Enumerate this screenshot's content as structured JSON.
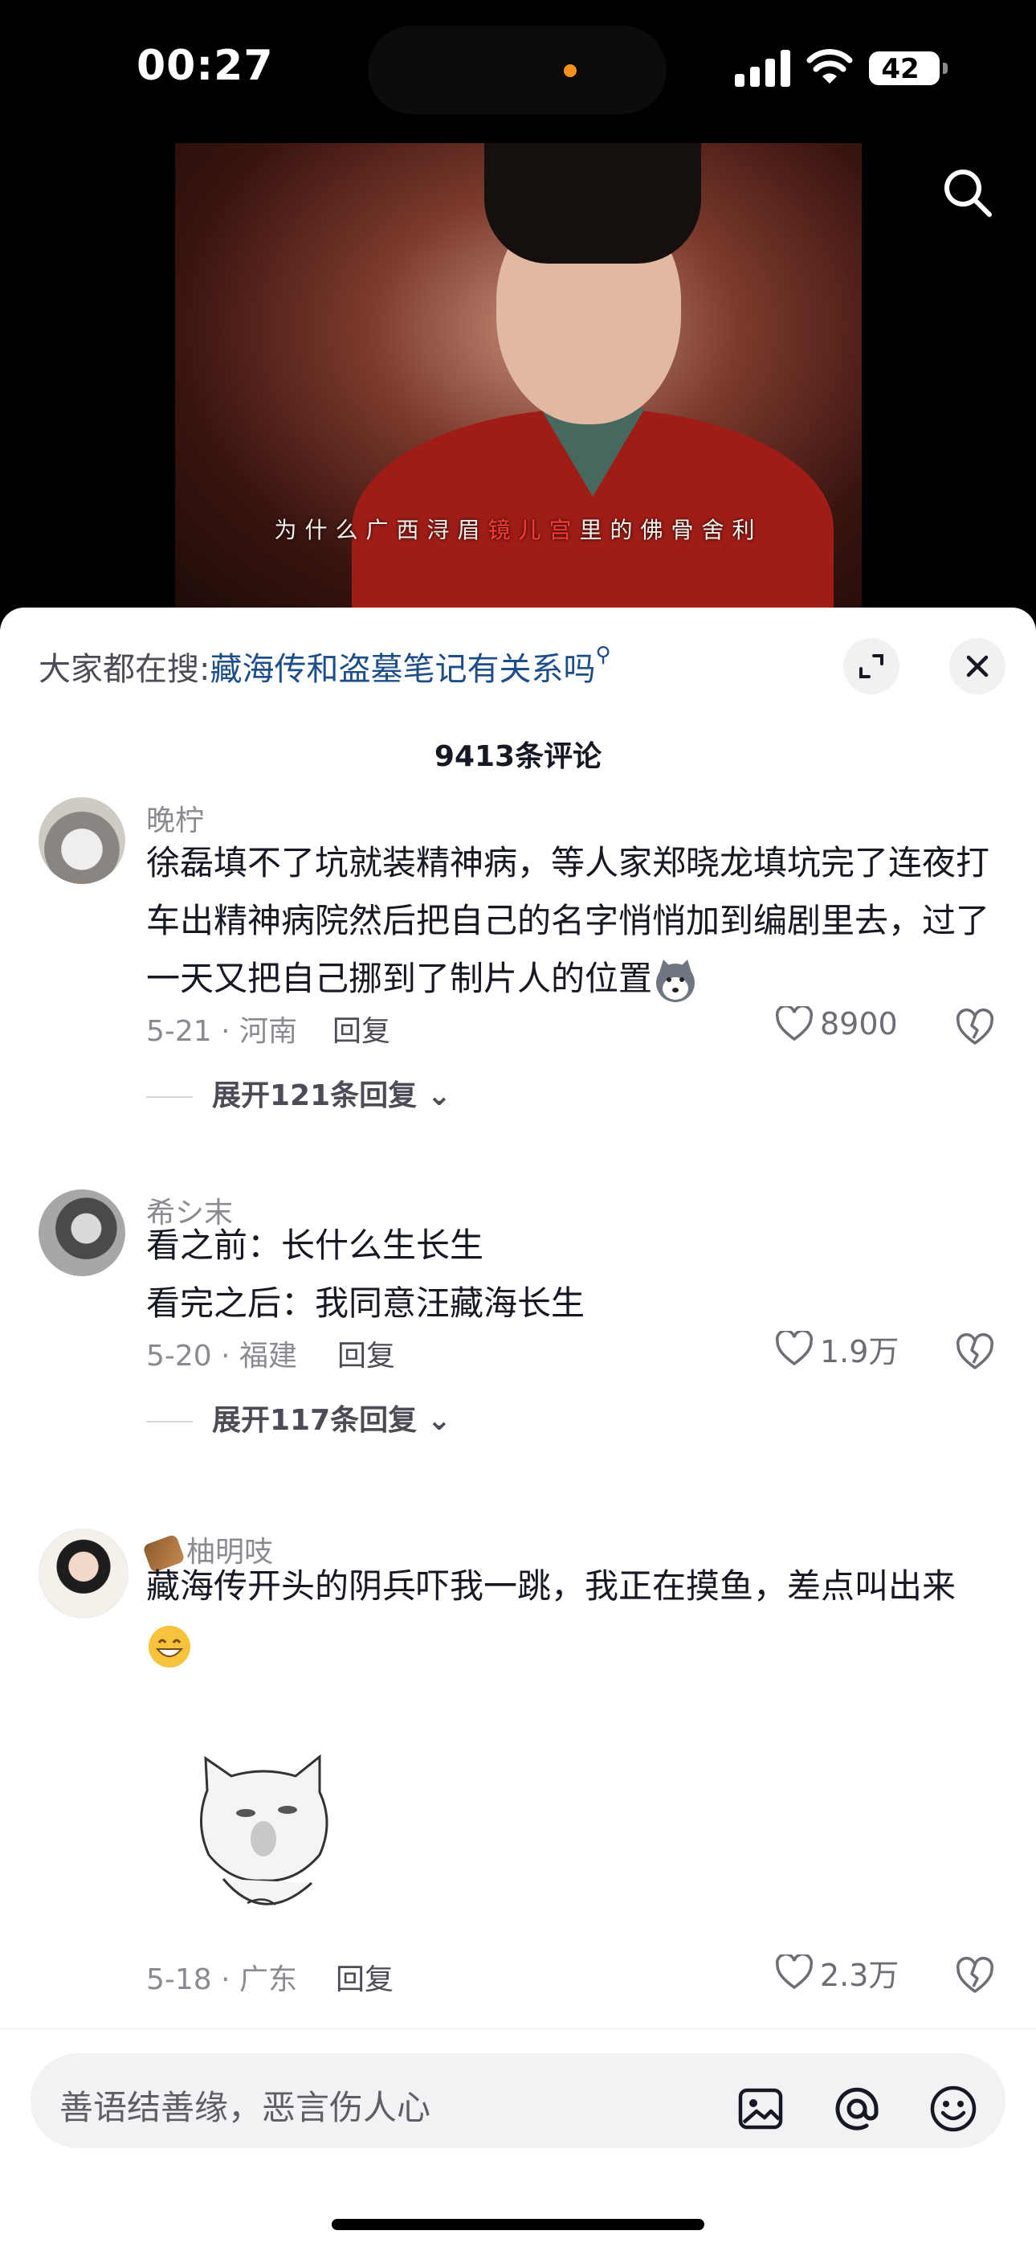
{
  "status_bar": {
    "time": "00:27",
    "battery": "42"
  },
  "video": {
    "subtitle_parts": [
      "为什么广西浔眉",
      "镜儿宫",
      "里的佛骨舍利"
    ]
  },
  "sheet": {
    "hot_search_prefix": "大家都在搜:",
    "hot_search_query": "藏海传和盗墓笔记有关系吗",
    "comment_count": "9413条评论"
  },
  "comments": [
    {
      "name": "晚柠",
      "text": "徐磊填不了坑就装精神病，等人家郑晓龙填坑完了连夜打车出精神病院然后把自己的名字悄悄加到编剧里去，过了一天又把自己挪到了制片人的位置",
      "date_loc": "5-21 · 河南",
      "reply": "回复",
      "likes": "8900",
      "expand": "展开121条回复"
    },
    {
      "name": "希シ末",
      "text_line1": "看之前：长什么生长生",
      "text_line2": "看完之后：我同意汪藏海长生",
      "date_loc": "5-20 · 福建",
      "reply": "回复",
      "likes": "1.9万",
      "expand": "展开117条回复"
    },
    {
      "name": "柚明吱",
      "text": "藏海传开头的阴兵吓我一跳，我正在摸鱼，差点叫出来",
      "date_loc": "5-18 · 广东",
      "reply": "回复",
      "likes": "2.3万"
    }
  ],
  "input_bar": {
    "placeholder": "善语结善缘，恶言伤人心"
  },
  "icons": {
    "search": "search-icon",
    "expand": "expand-icon",
    "close": "close-icon",
    "heart": "heart-icon",
    "dislike": "broken-heart-icon",
    "chevron": "chevron-down-icon",
    "image": "image-icon",
    "at": "at-icon",
    "emoji": "smiley-icon"
  },
  "colors": {
    "link": "#1d4e89",
    "highlight_subtitle": "#ff3a35"
  }
}
